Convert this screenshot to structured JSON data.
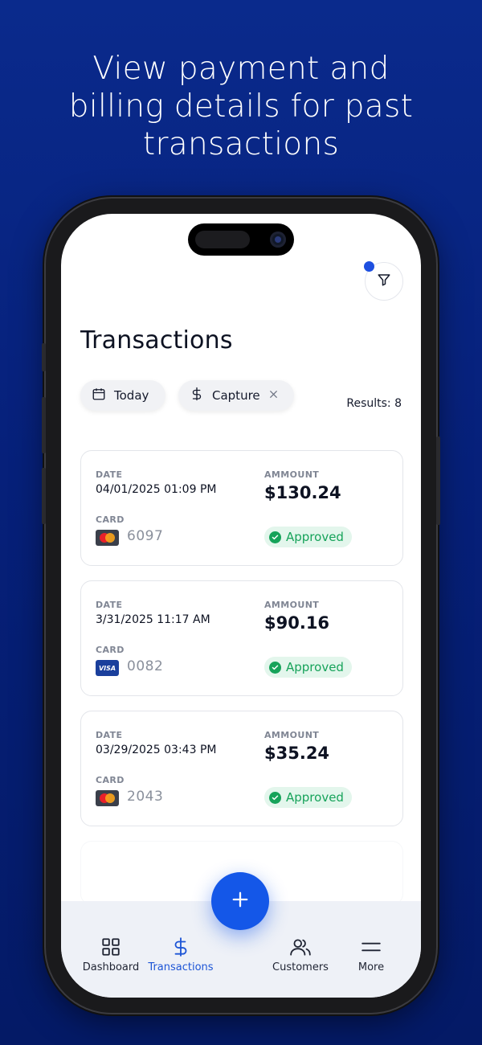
{
  "headline": {
    "line1": "View payment and",
    "line2": "billing details for past",
    "line3": "transactions"
  },
  "page": {
    "title": "Transactions",
    "results": "Results: 8"
  },
  "filters": {
    "today_label": "Today",
    "capture_label": "Capture"
  },
  "labels": {
    "date": "DATE",
    "amount": "AMMOUNT",
    "card": "CARD"
  },
  "transactions": [
    {
      "date": "04/01/2025  01:09 PM",
      "amount": "$130.24",
      "card_brand": "mastercard",
      "card_last4": "6097",
      "status": "Approved"
    },
    {
      "date": "3/31/2025  11:17 AM",
      "amount": "$90.16",
      "card_brand": "visa",
      "card_last4": "0082",
      "status": "Approved"
    },
    {
      "date": "03/29/2025  03:43 PM",
      "amount": "$35.24",
      "card_brand": "mastercard",
      "card_last4": "2043",
      "status": "Approved"
    }
  ],
  "visa_text": "VISA",
  "nav": {
    "dashboard": "Dashboard",
    "transactions": "Transactions",
    "customers": "Customers",
    "more": "More"
  },
  "colors": {
    "accent": "#1457e8",
    "approved": "#16a35a",
    "background": "#06207a"
  }
}
